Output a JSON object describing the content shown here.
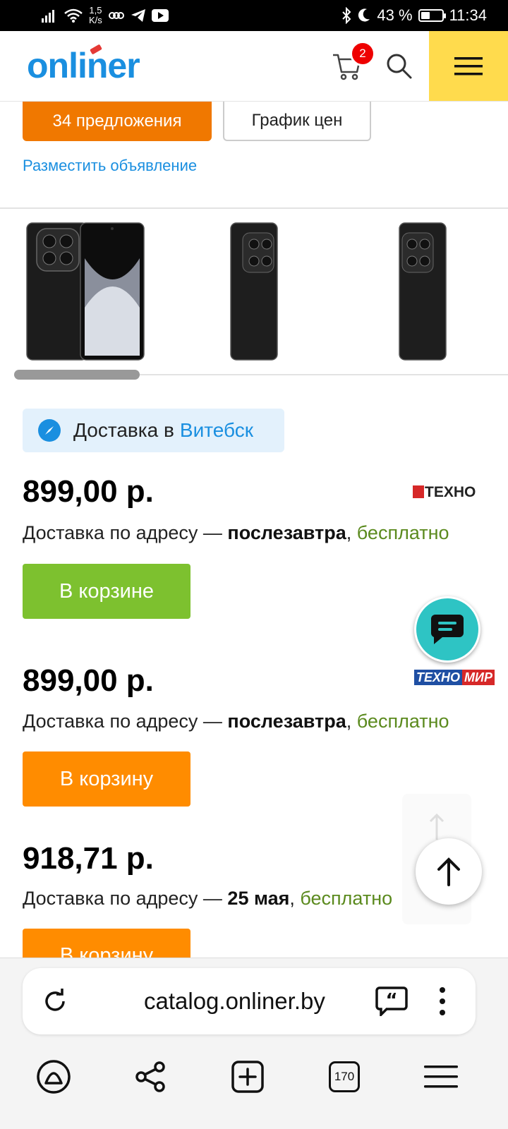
{
  "status_bar": {
    "speed_value": "1,5",
    "speed_unit": "K/s",
    "battery_percent": "43 %",
    "battery_level": 0.43,
    "time": "11:34"
  },
  "header": {
    "logo": "onliner",
    "cart_count": "2",
    "icons": [
      "cart-icon",
      "search-icon",
      "menu-icon"
    ]
  },
  "product_actions": {
    "offers_button": "34 предложения",
    "price_chart_button": "График цен",
    "place_ad_link": "Разместить объявление"
  },
  "delivery": {
    "prefix": "Доставка в",
    "city": "Витебск"
  },
  "offers": [
    {
      "price": "899,00 р.",
      "delivery_prefix": "Доставка по адресу —",
      "delivery_when": "послезавтра",
      "delivery_cost": "бесплатно",
      "button": "В корзине",
      "shop": "ТЕХНО"
    },
    {
      "price": "899,00 р.",
      "delivery_prefix": "Доставка по адресу —",
      "delivery_when": "послезавтра",
      "delivery_cost": "бесплатно",
      "button": "В корзину",
      "shop_part1": "ТЕХНО",
      "shop_part2": "МИР"
    },
    {
      "price": "918,71 р.",
      "delivery_prefix": "Доставка по адресу —",
      "delivery_when": "25 мая",
      "delivery_cost": "бесплатно",
      "button": "В корзину"
    }
  ],
  "browser": {
    "url": "catalog.onliner.by",
    "tabs_count": "170"
  },
  "colors": {
    "accent_blue": "#1a8fe0",
    "offers_orange": "#f07800",
    "in_cart_green": "#7dc12f",
    "add_orange": "#ff8c00",
    "free_green": "#5b8a1e",
    "menu_yellow": "#ffdb4d"
  }
}
